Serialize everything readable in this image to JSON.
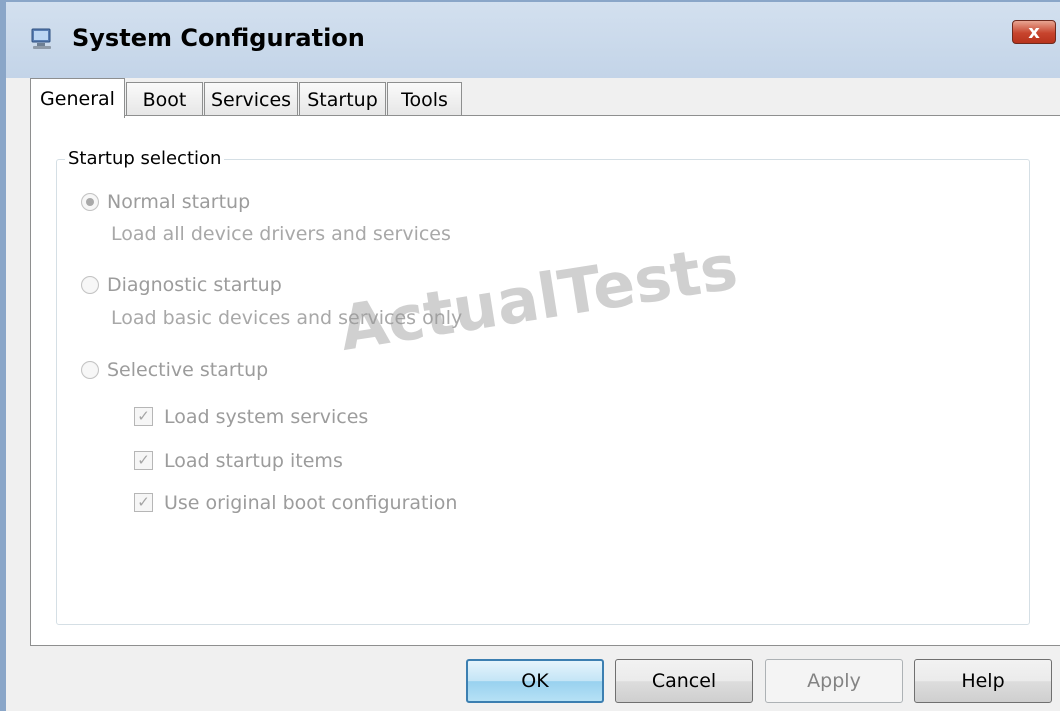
{
  "window": {
    "title": "System Configuration",
    "close_label": "x"
  },
  "tabs": [
    {
      "label": "General",
      "active": true
    },
    {
      "label": "Boot",
      "active": false
    },
    {
      "label": "Services",
      "active": false
    },
    {
      "label": "Startup",
      "active": false
    },
    {
      "label": "Tools",
      "active": false
    }
  ],
  "startup_selection": {
    "label": "Startup selection",
    "normal": {
      "label": "Normal startup",
      "description": "Load all device drivers and services",
      "checked": true
    },
    "diagnostic": {
      "label": "Diagnostic startup",
      "description": "Load basic devices and services only",
      "checked": false
    },
    "selective": {
      "label": "Selective startup",
      "checked": false,
      "options": [
        {
          "label": "Load system services",
          "checked": true
        },
        {
          "label": "Load startup items",
          "checked": true
        },
        {
          "label": "Use original boot configuration",
          "checked": true
        }
      ]
    }
  },
  "watermark": "ActualTests",
  "buttons": {
    "ok": "OK",
    "cancel": "Cancel",
    "apply": "Apply",
    "help": "Help"
  },
  "icons": {
    "check": "✓"
  },
  "colors": {
    "title_bar": "#c3d4e8",
    "close_button": "#c7442d",
    "disabled_text": "#9c9c9c"
  }
}
